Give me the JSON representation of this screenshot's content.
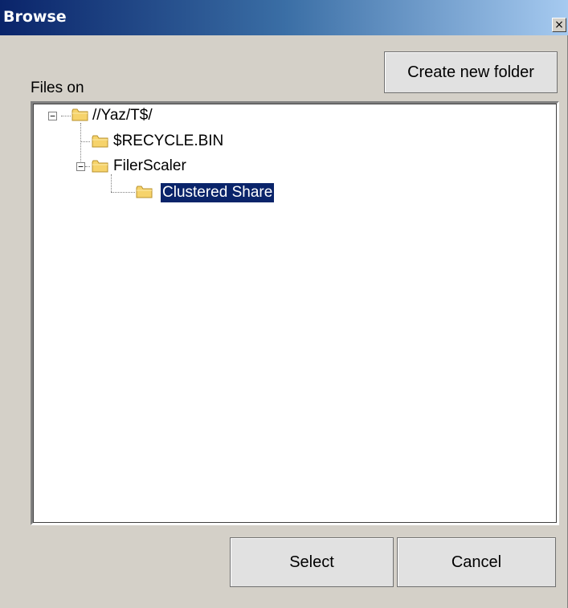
{
  "window": {
    "title": "Browse",
    "close_glyph": "×"
  },
  "files_label": "Files on",
  "buttons": {
    "create_folder": "Create new folder",
    "select": "Select",
    "cancel": "Cancel"
  },
  "tree": {
    "nodes": [
      {
        "label": "//Yaz/T$/",
        "level": 0,
        "expanded": true,
        "expander": "−",
        "icon": "folder-icon"
      },
      {
        "label": "$RECYCLE.BIN",
        "level": 1,
        "icon": "folder-icon"
      },
      {
        "label": "FilerScaler",
        "level": 1,
        "expanded": true,
        "expander": "−",
        "icon": "folder-icon"
      },
      {
        "label": "Clustered Share",
        "level": 2,
        "selected": true,
        "icon": "folder-icon"
      }
    ]
  },
  "colors": {
    "titlebar_start": "#0a246a",
    "titlebar_end": "#a6caf0",
    "selection": "#0a246a",
    "dialog_bg": "#d4d0c8",
    "folder": "#f6d36b"
  }
}
